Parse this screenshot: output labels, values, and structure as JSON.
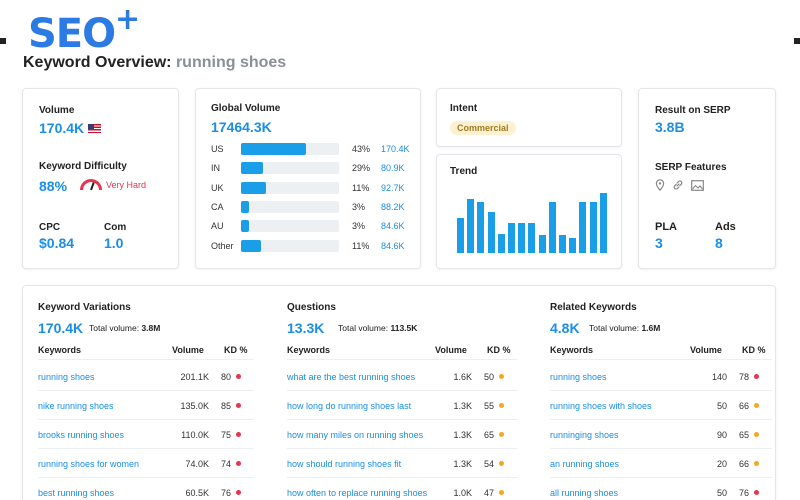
{
  "brand": {
    "name": "SEO",
    "plus": "+"
  },
  "header": {
    "title_prefix": "Keyword Overview:",
    "keyword": "running shoes"
  },
  "metrics": {
    "volume_label": "Volume",
    "volume_value": "170.4K",
    "kd_label": "Keyword Difficulty",
    "kd_value": "88%",
    "kd_text": "Very Hard",
    "cpc_label": "CPC",
    "cpc_value": "$0.84",
    "com_label": "Com",
    "com_value": "1.0"
  },
  "global_volume": {
    "label": "Global Volume",
    "value": "17464.3K",
    "rows": [
      {
        "country": "US",
        "pct": "43%",
        "value": "170.4K",
        "fraction": 0.66
      },
      {
        "country": "IN",
        "pct": "29%",
        "value": "80.9K",
        "fraction": 0.22
      },
      {
        "country": "UK",
        "pct": "11%",
        "value": "92.7K",
        "fraction": 0.25
      },
      {
        "country": "CA",
        "pct": "3%",
        "value": "88.2K",
        "fraction": 0.08
      },
      {
        "country": "AU",
        "pct": "3%",
        "value": "84.6K",
        "fraction": 0.08
      },
      {
        "country": "Other",
        "pct": "11%",
        "value": "84.6K",
        "fraction": 0.2
      }
    ]
  },
  "intent": {
    "label": "Intent",
    "value": "Commercial"
  },
  "trend": {
    "label": "Trend",
    "values": [
      0.58,
      0.9,
      0.85,
      0.69,
      0.32,
      0.5,
      0.5,
      0.5,
      0.3,
      0.85,
      0.3,
      0.25,
      0.85,
      0.85,
      1.0
    ]
  },
  "serp": {
    "result_label": "Result on SERP",
    "result_value": "3.8B",
    "features_label": "SERP Features",
    "features_icons": [
      "location-icon",
      "link-icon",
      "image-icon"
    ],
    "pla_label": "PLA",
    "pla_value": "3",
    "ads_label": "Ads",
    "ads_value": "8"
  },
  "colors": {
    "accent": "#1a8ee8",
    "red": "#e8344e",
    "orange": "#f5a623"
  },
  "sections": [
    {
      "title": "Keyword Variations",
      "count": "170.4K",
      "total_label": "Total volume:",
      "total_value": "3.8M",
      "col_keywords": "Keywords",
      "col_volume": "Volume",
      "col_kd": "KD %",
      "rows": [
        {
          "keyword": "running shoes",
          "volume": "201.1K",
          "kd": "80",
          "kd_color": "#e8344e"
        },
        {
          "keyword": "nike running shoes",
          "volume": "135.0K",
          "kd": "85",
          "kd_color": "#e8344e"
        },
        {
          "keyword": "brooks running shoes",
          "volume": "110.0K",
          "kd": "75",
          "kd_color": "#e8344e"
        },
        {
          "keyword": "running shoes for women",
          "volume": "74.0K",
          "kd": "74",
          "kd_color": "#e8344e"
        },
        {
          "keyword": "best running shoes",
          "volume": "60.5K",
          "kd": "76",
          "kd_color": "#e8344e"
        }
      ]
    },
    {
      "title": "Questions",
      "count": "13.3K",
      "total_label": "Total volume:",
      "total_value": "113.5K",
      "col_keywords": "Keywords",
      "col_volume": "Volume",
      "col_kd": "KD %",
      "rows": [
        {
          "keyword": "what are the best running shoes",
          "volume": "1.6K",
          "kd": "50",
          "kd_color": "#f5a623"
        },
        {
          "keyword": "how long do running shoes last",
          "volume": "1.3K",
          "kd": "55",
          "kd_color": "#f5a623"
        },
        {
          "keyword": "how many miles on running shoes",
          "volume": "1.3K",
          "kd": "65",
          "kd_color": "#f5a623"
        },
        {
          "keyword": "how should running shoes fit",
          "volume": "1.3K",
          "kd": "54",
          "kd_color": "#f5a623"
        },
        {
          "keyword": "how often to replace running shoes",
          "volume": "1.0K",
          "kd": "47",
          "kd_color": "#f5a623"
        }
      ]
    },
    {
      "title": "Related Keywords",
      "count": "4.8K",
      "total_label": "Total volume:",
      "total_value": "1.6M",
      "col_keywords": "Keywords",
      "col_volume": "Volume",
      "col_kd": "KD %",
      "rows": [
        {
          "keyword": "running shoes",
          "volume": "140",
          "kd": "78",
          "kd_color": "#e8344e"
        },
        {
          "keyword": "running shoes with shoes",
          "volume": "50",
          "kd": "66",
          "kd_color": "#f5a623"
        },
        {
          "keyword": "runninging shoes",
          "volume": "90",
          "kd": "65",
          "kd_color": "#f5a623"
        },
        {
          "keyword": "an running shoes",
          "volume": "20",
          "kd": "66",
          "kd_color": "#f5a623"
        },
        {
          "keyword": "all running shoes",
          "volume": "50",
          "kd": "76",
          "kd_color": "#e8344e"
        }
      ]
    }
  ]
}
